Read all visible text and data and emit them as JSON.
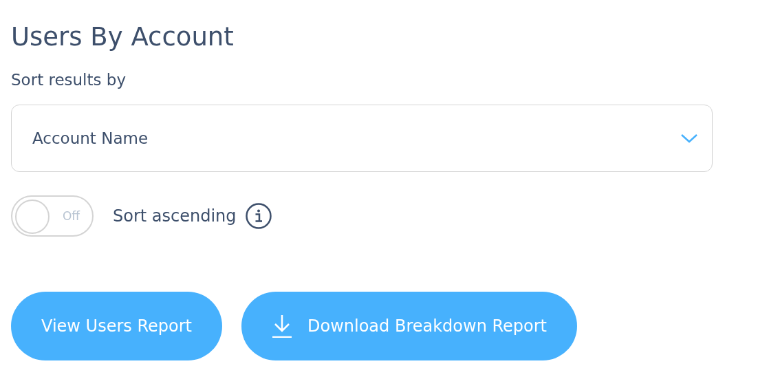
{
  "title": "Users By Account",
  "sort": {
    "label": "Sort results by",
    "value": "Account Name"
  },
  "toggle": {
    "on": false,
    "state_label": "Off",
    "label": "Sort ascending"
  },
  "buttons": [
    {
      "kind": "plain",
      "label": "View Users Report"
    },
    {
      "kind": "download",
      "label": "Download Breakdown Report"
    }
  ]
}
